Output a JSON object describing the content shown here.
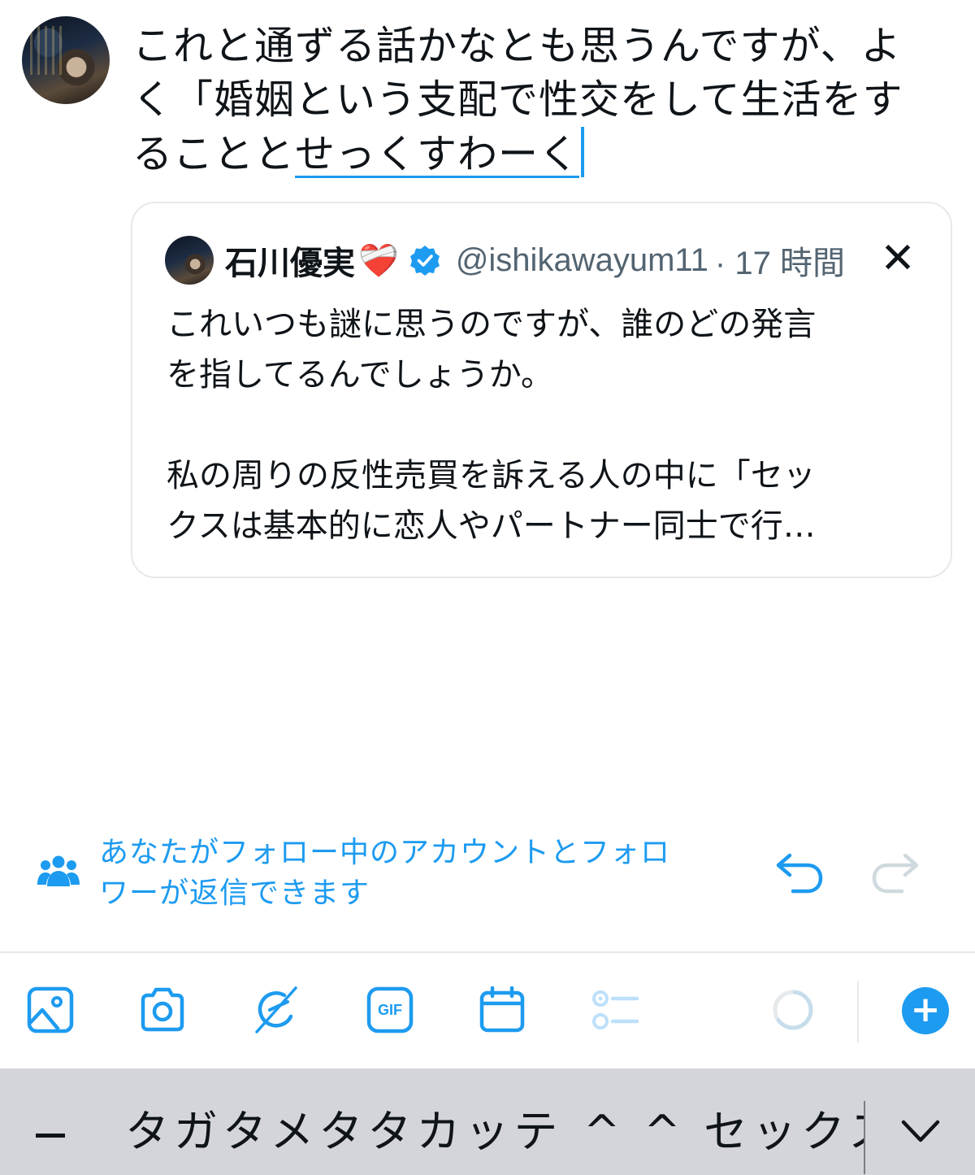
{
  "composer": {
    "text_line1": "これと通ずる話かなとも思うんですが、よ",
    "text_line2": "く「婚姻という支配で性交をして生活をす",
    "text_line3_prefix": "ることと",
    "text_line3_composing": "せっくすわーく"
  },
  "quote": {
    "author_name": "石川優実",
    "author_emoji": "❤️‍🩹",
    "handle": "@ishikawayum11",
    "time": "· 17 時間",
    "close_icon": "x-close-icon",
    "body": "これいつも謎に思うのですが、誰のどの発言\nを指してるんでしょうか。\n\n私の周りの反性売買を訴える人の中に「セッ\nクスは基本的に恋人やパートナー同士で行…"
  },
  "reply_settings": {
    "text_line1": "あなたがフォロー中のアカウントとフォロ",
    "text_line2": "ワーが返信できます",
    "icon": "people-icon"
  },
  "toolbar": {
    "buttons": [
      "image-icon",
      "camera-icon",
      "grok-icon",
      "gif-icon",
      "schedule-icon",
      "poll-icon",
      "progress-ring",
      "add-icon"
    ],
    "gif_label": "GIF",
    "add_label": "+"
  },
  "keyboard": {
    "candidates": [
      "_",
      "タガタメタタカッテ",
      "^ ^",
      "セックス"
    ],
    "expand_icon": "chevron-down-icon"
  },
  "colors": {
    "accent": "#1d9bf0",
    "text": "#0f1419",
    "secondary": "#536471",
    "border": "#e6e9eb",
    "keyboard_bg": "#d3d5da"
  }
}
